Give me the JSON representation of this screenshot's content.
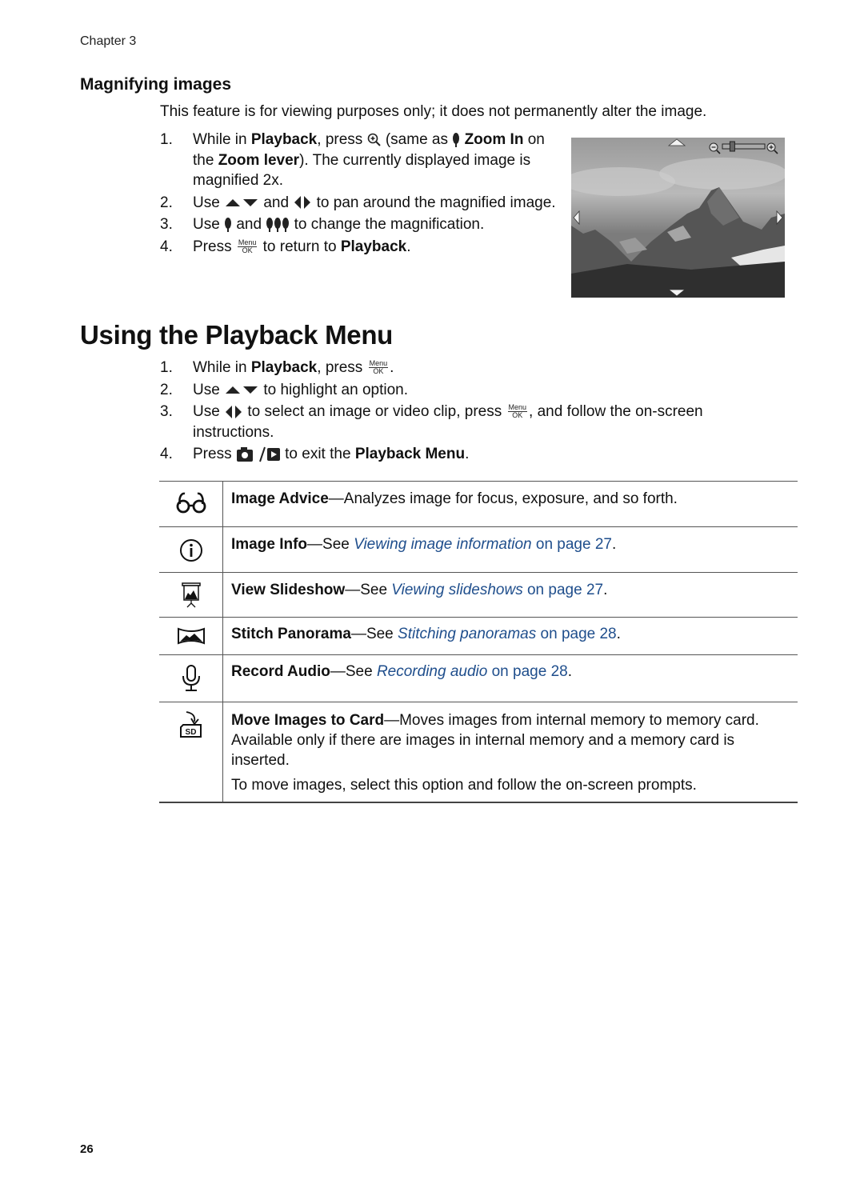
{
  "header": {
    "chapter": "Chapter 3"
  },
  "magnify": {
    "title": "Magnifying images",
    "intro": "This feature is for viewing purposes only; it does not permanently alter the image.",
    "steps": [
      {
        "num": "1.",
        "a": "While in ",
        "b": "Playback",
        "c": ", press ",
        "icon": "zoom-in-magnifier-icon",
        "d": " (same as ",
        "icon2": "single-tree-zoom-in-icon",
        "e": "Zoom In",
        "f": "on the ",
        "g": "Zoom lever",
        "h": "). The currently displayed image is magnified 2x."
      },
      {
        "num": "2.",
        "a": "Use ",
        "icon": "up-down-arrows-icon",
        "b": " and ",
        "icon2": "left-right-arrows-icon",
        "c": " to pan around the magnified image."
      },
      {
        "num": "3.",
        "a": "Use ",
        "icon": "single-tree-icon",
        "b": " and ",
        "icon2": "three-trees-icon",
        "c": " to change the magnification."
      },
      {
        "num": "4.",
        "a": "Press ",
        "icon": "menu-ok-button-icon",
        "b": " to return to ",
        "c": "Playback",
        "d": "."
      }
    ],
    "menu_ok": {
      "top": "Menu",
      "bottom": "OK"
    },
    "photo": {
      "label": "Magnified mountain image on camera screen",
      "zoom_level": 0.2
    }
  },
  "playback": {
    "title": "Using the Playback Menu",
    "steps": [
      {
        "num": "1.",
        "a": "While in ",
        "b": "Playback",
        "c": ", press ",
        "d": "."
      },
      {
        "num": "2.",
        "a": "Use ",
        "b": " to highlight an option."
      },
      {
        "num": "3.",
        "a": "Use ",
        "b": " to select an image or video clip, press ",
        "c": ", and follow the on-screen instructions."
      },
      {
        "num": "4.",
        "a": "Press ",
        "b": " to exit the ",
        "c": "Playback Menu",
        "d": "."
      }
    ],
    "menu_items": [
      {
        "icon": "glasses-icon",
        "title": "Image Advice",
        "dash": "—",
        "desc": "Analyzes image for focus, exposure, and so forth."
      },
      {
        "icon": "info-icon",
        "title": "Image Info",
        "dash": "—See ",
        "link": "Viewing image information",
        "page": " on page 27",
        "end": "."
      },
      {
        "icon": "slideshow-icon",
        "title": "View Slideshow",
        "dash": "—See ",
        "link": "Viewing slideshows",
        "page": " on page 27",
        "end": "."
      },
      {
        "icon": "panorama-icon",
        "title": "Stitch Panorama",
        "dash": "—See ",
        "link": "Stitching panoramas",
        "page": " on page 28",
        "end": "."
      },
      {
        "icon": "microphone-icon",
        "title": "Record Audio",
        "dash": "—See ",
        "link": "Recording audio",
        "page": " on page 28",
        "end": "."
      },
      {
        "icon": "move-to-sd-card-icon",
        "title": "Move Images to Card",
        "dash": "—",
        "desc": "Moves images from internal memory to memory card. Available only if there are images in internal memory and a memory card is inserted.",
        "note": "To move images, select this option and follow the on-screen prompts."
      }
    ]
  },
  "footer": {
    "page_number": "26"
  },
  "colors": {
    "link": "#1f4e8c",
    "text": "#111111",
    "rule": "#555555"
  }
}
